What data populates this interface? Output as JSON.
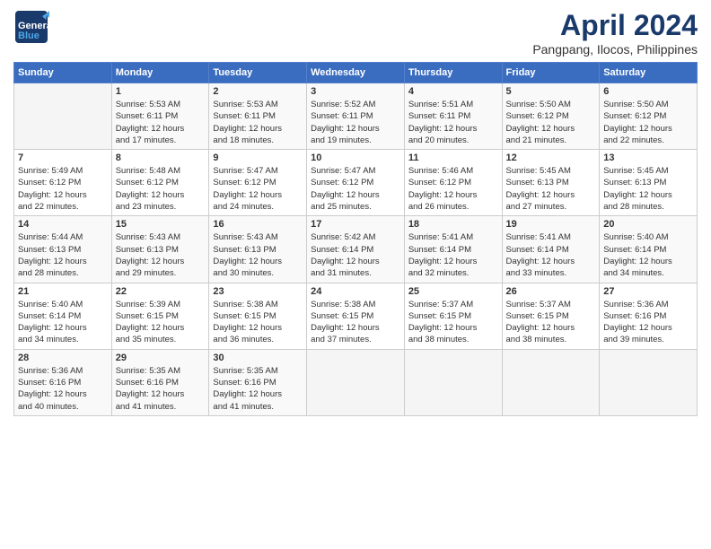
{
  "header": {
    "logo_general": "General",
    "logo_blue": "Blue",
    "title": "April 2024",
    "subtitle": "Pangpang, Ilocos, Philippines"
  },
  "calendar": {
    "days_of_week": [
      "Sunday",
      "Monday",
      "Tuesday",
      "Wednesday",
      "Thursday",
      "Friday",
      "Saturday"
    ],
    "weeks": [
      [
        {
          "day": "",
          "info": ""
        },
        {
          "day": "1",
          "info": "Sunrise: 5:53 AM\nSunset: 6:11 PM\nDaylight: 12 hours\nand 17 minutes."
        },
        {
          "day": "2",
          "info": "Sunrise: 5:53 AM\nSunset: 6:11 PM\nDaylight: 12 hours\nand 18 minutes."
        },
        {
          "day": "3",
          "info": "Sunrise: 5:52 AM\nSunset: 6:11 PM\nDaylight: 12 hours\nand 19 minutes."
        },
        {
          "day": "4",
          "info": "Sunrise: 5:51 AM\nSunset: 6:11 PM\nDaylight: 12 hours\nand 20 minutes."
        },
        {
          "day": "5",
          "info": "Sunrise: 5:50 AM\nSunset: 6:12 PM\nDaylight: 12 hours\nand 21 minutes."
        },
        {
          "day": "6",
          "info": "Sunrise: 5:50 AM\nSunset: 6:12 PM\nDaylight: 12 hours\nand 22 minutes."
        }
      ],
      [
        {
          "day": "7",
          "info": "Sunrise: 5:49 AM\nSunset: 6:12 PM\nDaylight: 12 hours\nand 22 minutes."
        },
        {
          "day": "8",
          "info": "Sunrise: 5:48 AM\nSunset: 6:12 PM\nDaylight: 12 hours\nand 23 minutes."
        },
        {
          "day": "9",
          "info": "Sunrise: 5:47 AM\nSunset: 6:12 PM\nDaylight: 12 hours\nand 24 minutes."
        },
        {
          "day": "10",
          "info": "Sunrise: 5:47 AM\nSunset: 6:12 PM\nDaylight: 12 hours\nand 25 minutes."
        },
        {
          "day": "11",
          "info": "Sunrise: 5:46 AM\nSunset: 6:12 PM\nDaylight: 12 hours\nand 26 minutes."
        },
        {
          "day": "12",
          "info": "Sunrise: 5:45 AM\nSunset: 6:13 PM\nDaylight: 12 hours\nand 27 minutes."
        },
        {
          "day": "13",
          "info": "Sunrise: 5:45 AM\nSunset: 6:13 PM\nDaylight: 12 hours\nand 28 minutes."
        }
      ],
      [
        {
          "day": "14",
          "info": "Sunrise: 5:44 AM\nSunset: 6:13 PM\nDaylight: 12 hours\nand 28 minutes."
        },
        {
          "day": "15",
          "info": "Sunrise: 5:43 AM\nSunset: 6:13 PM\nDaylight: 12 hours\nand 29 minutes."
        },
        {
          "day": "16",
          "info": "Sunrise: 5:43 AM\nSunset: 6:13 PM\nDaylight: 12 hours\nand 30 minutes."
        },
        {
          "day": "17",
          "info": "Sunrise: 5:42 AM\nSunset: 6:14 PM\nDaylight: 12 hours\nand 31 minutes."
        },
        {
          "day": "18",
          "info": "Sunrise: 5:41 AM\nSunset: 6:14 PM\nDaylight: 12 hours\nand 32 minutes."
        },
        {
          "day": "19",
          "info": "Sunrise: 5:41 AM\nSunset: 6:14 PM\nDaylight: 12 hours\nand 33 minutes."
        },
        {
          "day": "20",
          "info": "Sunrise: 5:40 AM\nSunset: 6:14 PM\nDaylight: 12 hours\nand 34 minutes."
        }
      ],
      [
        {
          "day": "21",
          "info": "Sunrise: 5:40 AM\nSunset: 6:14 PM\nDaylight: 12 hours\nand 34 minutes."
        },
        {
          "day": "22",
          "info": "Sunrise: 5:39 AM\nSunset: 6:15 PM\nDaylight: 12 hours\nand 35 minutes."
        },
        {
          "day": "23",
          "info": "Sunrise: 5:38 AM\nSunset: 6:15 PM\nDaylight: 12 hours\nand 36 minutes."
        },
        {
          "day": "24",
          "info": "Sunrise: 5:38 AM\nSunset: 6:15 PM\nDaylight: 12 hours\nand 37 minutes."
        },
        {
          "day": "25",
          "info": "Sunrise: 5:37 AM\nSunset: 6:15 PM\nDaylight: 12 hours\nand 38 minutes."
        },
        {
          "day": "26",
          "info": "Sunrise: 5:37 AM\nSunset: 6:15 PM\nDaylight: 12 hours\nand 38 minutes."
        },
        {
          "day": "27",
          "info": "Sunrise: 5:36 AM\nSunset: 6:16 PM\nDaylight: 12 hours\nand 39 minutes."
        }
      ],
      [
        {
          "day": "28",
          "info": "Sunrise: 5:36 AM\nSunset: 6:16 PM\nDaylight: 12 hours\nand 40 minutes."
        },
        {
          "day": "29",
          "info": "Sunrise: 5:35 AM\nSunset: 6:16 PM\nDaylight: 12 hours\nand 41 minutes."
        },
        {
          "day": "30",
          "info": "Sunrise: 5:35 AM\nSunset: 6:16 PM\nDaylight: 12 hours\nand 41 minutes."
        },
        {
          "day": "",
          "info": ""
        },
        {
          "day": "",
          "info": ""
        },
        {
          "day": "",
          "info": ""
        },
        {
          "day": "",
          "info": ""
        }
      ]
    ]
  }
}
